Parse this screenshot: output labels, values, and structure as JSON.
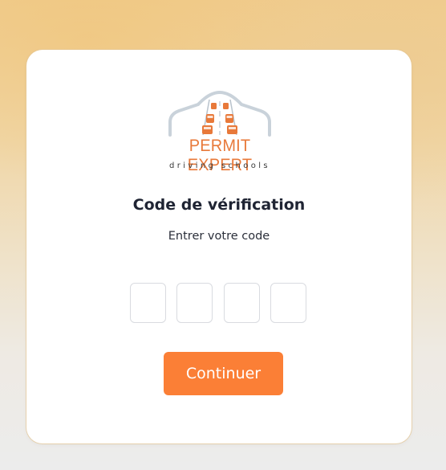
{
  "brand": {
    "name": "PERMIT EXPERT",
    "tagline": "driving schools",
    "logo_icon": "road-cars-arch-icon"
  },
  "verification": {
    "title": "Code de vérification",
    "subtitle": "Entrer votre code",
    "code_digits": [
      "",
      "",
      "",
      ""
    ]
  },
  "actions": {
    "continue_label": "Continuer"
  },
  "colors": {
    "accent": "#fb7f36",
    "brand_orange": "#e8793a",
    "logo_arch": "#c9d2da",
    "title_text": "#1f2433"
  }
}
